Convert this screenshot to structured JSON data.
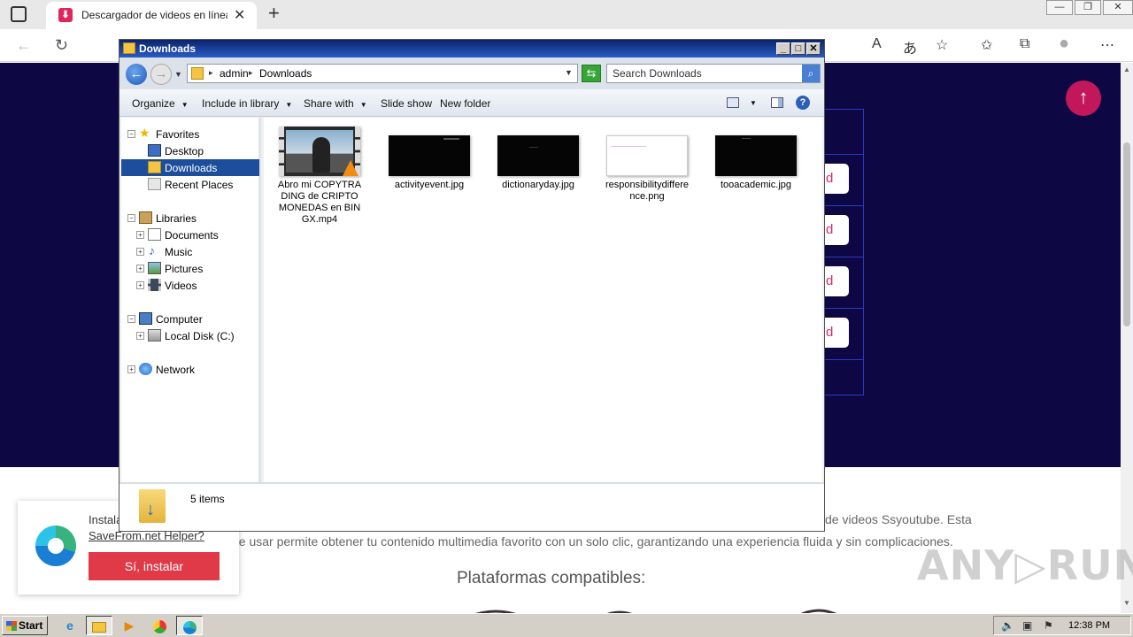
{
  "browser": {
    "tab_title": "Descargador de videos en línea",
    "tab_close": "✕",
    "new_tab": "+",
    "window_buttons": [
      "—",
      "❐",
      "✕"
    ],
    "nav_back": "←",
    "nav_reload": "↻",
    "toolbar_icons": [
      "A",
      "あ",
      "☆",
      "✩",
      "⧉",
      "●",
      "⋯"
    ]
  },
  "page": {
    "download_btn_label": "d",
    "scroll_up": "↑",
    "description_line1": "de videos Ssyoutube. Esta",
    "description_line2": "de usar permite obtener tu contenido multimedia favorito con un solo clic, garantizando una experiencia fluida y sin complicaciones.",
    "platforms_heading": "Plataformas compatibles:",
    "watermark": "ANY▷RUN"
  },
  "popup": {
    "text": "Instalar",
    "link": "SaveFrom.net Helper?",
    "button": "Sí, instalar"
  },
  "explorer": {
    "title": "Downloads",
    "title_buttons": [
      "_",
      "□",
      "✕"
    ],
    "breadcrumb": [
      "admin",
      "Downloads"
    ],
    "search_placeholder": "Search Downloads",
    "commands": {
      "organize": "Organize",
      "include_library": "Include in library",
      "share_with": "Share with",
      "slide_show": "Slide show",
      "new_folder": "New folder"
    },
    "nav": {
      "favorites": "Favorites",
      "desktop": "Desktop",
      "downloads": "Downloads",
      "recent": "Recent Places",
      "libraries": "Libraries",
      "documents": "Documents",
      "music": "Music",
      "pictures": "Pictures",
      "videos": "Videos",
      "computer": "Computer",
      "local_disk": "Local Disk (C:)",
      "network": "Network"
    },
    "files": [
      {
        "name": "Abro mi COPYTRADING de CRIPTOMONEDAS en BINGX.mp4",
        "kind": "video"
      },
      {
        "name": "activityevent.jpg",
        "kind": "dark"
      },
      {
        "name": "dictionaryday.jpg",
        "kind": "dark"
      },
      {
        "name": "responsibilitydifference.png",
        "kind": "light"
      },
      {
        "name": "tooacademic.jpg",
        "kind": "dark"
      }
    ],
    "status": "5 items"
  },
  "taskbar": {
    "start": "Start",
    "clock": "12:38 PM"
  }
}
